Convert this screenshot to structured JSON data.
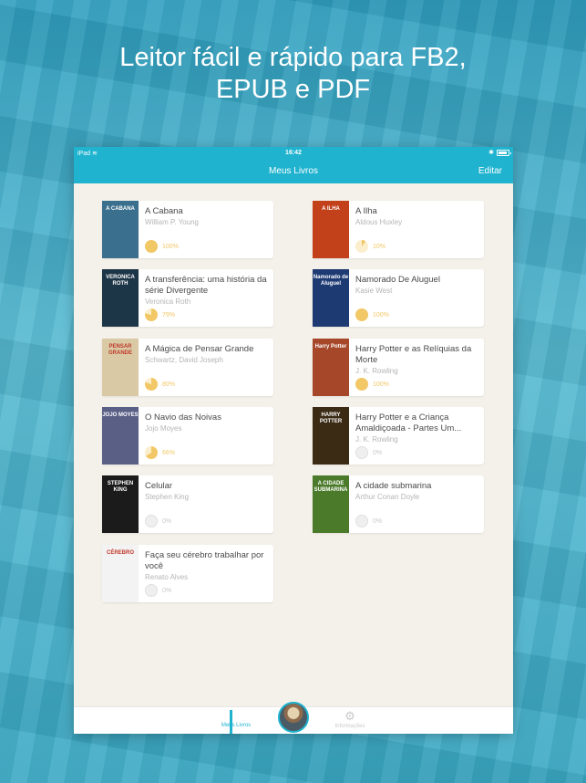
{
  "headline": {
    "line1": "Leitor fácil e rápido para FB2,",
    "line2": "EPUB e PDF"
  },
  "statusbar": {
    "carrier": "iPad",
    "time": "16:42"
  },
  "navbar": {
    "title": "Meus Livros",
    "edit_label": "Editar"
  },
  "books": [
    {
      "title": "A Cabana",
      "author": "William P. Young",
      "progress_label": "100%",
      "progress": 1.0,
      "cover_color": "#3b6f8e",
      "cover_text": "A CABANA"
    },
    {
      "title": "A Ilha",
      "author": "Aldous Huxley",
      "progress_label": "10%",
      "progress": 0.1,
      "cover_color": "#c2401a",
      "cover_text": "A ILHA"
    },
    {
      "title": "A transferência: uma história da série Divergente",
      "author": "Veronica Roth",
      "progress_label": "79%",
      "progress": 0.79,
      "cover_color": "#1c3547",
      "cover_text": "VERONICA ROTH"
    },
    {
      "title": "Namorado De Aluguel",
      "author": "Kasie West",
      "progress_label": "100%",
      "progress": 1.0,
      "cover_color": "#1d3a73",
      "cover_text": "Namorado de Aluguel"
    },
    {
      "title": "A Mágica de Pensar Grande",
      "author": "Schwartz, David Joseph",
      "progress_label": "80%",
      "progress": 0.8,
      "cover_color": "#d9c9a4",
      "cover_text": "PENSAR GRANDE"
    },
    {
      "title": "Harry Potter e as Relíquias da Morte",
      "author": "J. K. Rowling",
      "progress_label": "100%",
      "progress": 1.0,
      "cover_color": "#a6472a",
      "cover_text": "Harry Potter"
    },
    {
      "title": "O Navio das Noivas",
      "author": "Jojo Moyes",
      "progress_label": "66%",
      "progress": 0.66,
      "cover_color": "#5a5f86",
      "cover_text": "JOJO MOYES"
    },
    {
      "title": "Harry Potter e a Criança Amaldiçoada - Partes Um...",
      "author": "J. K. Rowling",
      "progress_label": "0%",
      "progress": 0.0,
      "cover_color": "#3b2a14",
      "cover_text": "HARRY POTTER"
    },
    {
      "title": "Celular",
      "author": "Stephen King",
      "progress_label": "0%",
      "progress": 0.0,
      "cover_color": "#1b1b1b",
      "cover_text": "STEPHEN KING"
    },
    {
      "title": "A cidade submarina",
      "author": "Arthur Conan Doyle",
      "progress_label": "0%",
      "progress": 0.0,
      "cover_color": "#4a7a2a",
      "cover_text": "A CIDADE SUBMARINA"
    },
    {
      "title": "Faça seu cérebro trabalhar por você",
      "author": "Renato Alves",
      "progress_label": "0%",
      "progress": 0.0,
      "cover_color": "#f3f3f3",
      "cover_text": "CÉREBRO"
    }
  ],
  "tabbar": {
    "books_label": "Meus Livros",
    "info_label": "Informações"
  },
  "colors": {
    "accent": "#1fb3cf",
    "progress": "#f2c766"
  }
}
